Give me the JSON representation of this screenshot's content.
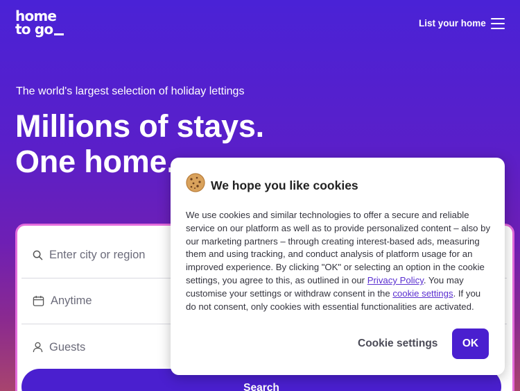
{
  "header": {
    "logo_line1": "home",
    "logo_line2": "to go",
    "list_home": "List your home",
    "menu_icon": "hamburger-menu-icon"
  },
  "hero": {
    "tagline": "The world's largest selection of holiday lettings",
    "headline_line1": "Millions of stays.",
    "headline_line2": "One home."
  },
  "search": {
    "destination_placeholder": "Enter city or region",
    "dates": "Anytime",
    "guests": "Guests",
    "button": "Search",
    "icons": [
      "search-icon",
      "calendar-icon",
      "person-icon"
    ]
  },
  "cookie_dialog": {
    "icon": "cookie-icon",
    "title": "We hope you like cookies",
    "text_before_privacy": "We use cookies and similar technologies to offer a secure and reliable service on our platform as well as to provide personalized content – also by our marketing partners – through creating interest-based ads, measuring them and using tracking, and conduct analysis of platform usage for an improved experience. By clicking \"OK\" or selecting an option in the cookie settings, you agree to this, as outlined in our ",
    "privacy_link": "Privacy Policy",
    "text_middle": ". You may customise your settings or withdraw consent in the ",
    "settings_link": "cookie settings",
    "text_after": ". If you do not consent, only cookies with essential functionalities are activated.",
    "settings_button": "Cookie settings",
    "ok_button": "OK"
  },
  "colors": {
    "brand_purple": "#4a1fcf",
    "search_border": "#e46cdc",
    "link": "#5a2fd0"
  }
}
